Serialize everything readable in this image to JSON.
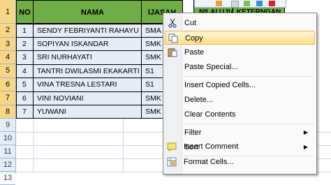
{
  "sheet": {
    "row_numbers": [
      "1",
      "2",
      "3",
      "4",
      "5",
      "6",
      "7",
      "8",
      "9",
      "10",
      "11",
      "12",
      "13"
    ],
    "headers": [
      "NO",
      "NAMA",
      "IJASAH",
      "NILAI UJIAN",
      "KETERNGAN"
    ],
    "rows": [
      {
        "no": "1",
        "nama": "SENDY FEBRIYANTI RAHAYU",
        "ijasah": "SMA"
      },
      {
        "no": "2",
        "nama": "SOPIYAN ISKANDAR",
        "ijasah": "SMK"
      },
      {
        "no": "3",
        "nama": "SRI NURHAYATI",
        "ijasah": "SMK"
      },
      {
        "no": "4",
        "nama": "TANTRI DWILASMI EKAKARTI",
        "ijasah": "S1"
      },
      {
        "no": "5",
        "nama": "VINA TRESNA LESTARI",
        "ijasah": "S1"
      },
      {
        "no": "6",
        "nama": "VINI NOVIANI",
        "ijasah": "SMK"
      },
      {
        "no": "7",
        "nama": "YUWANI",
        "ijasah": "SMK"
      }
    ]
  },
  "context_menu": {
    "items": [
      {
        "label": "Cut",
        "icon": "scissors-icon"
      },
      {
        "label": "Copy",
        "icon": "copy-icon"
      },
      {
        "label": "Paste",
        "icon": "paste-icon"
      },
      {
        "label": "Paste Special..."
      },
      {
        "label": "Insert Copied Cells..."
      },
      {
        "label": "Delete..."
      },
      {
        "label": "Clear Contents"
      },
      {
        "label": "Filter"
      },
      {
        "label": "Sort"
      },
      {
        "label": "Insert Comment",
        "icon": "comment-icon"
      },
      {
        "label": "Format Cells...",
        "icon": "format-cells-icon"
      }
    ],
    "highlighted": "Copy"
  },
  "colors": {
    "header_fill": "#70ad47",
    "row_fill": "#e6ecf7",
    "menu_highlight": "#ffdf8a",
    "selected_row_header": "#f8d686"
  }
}
